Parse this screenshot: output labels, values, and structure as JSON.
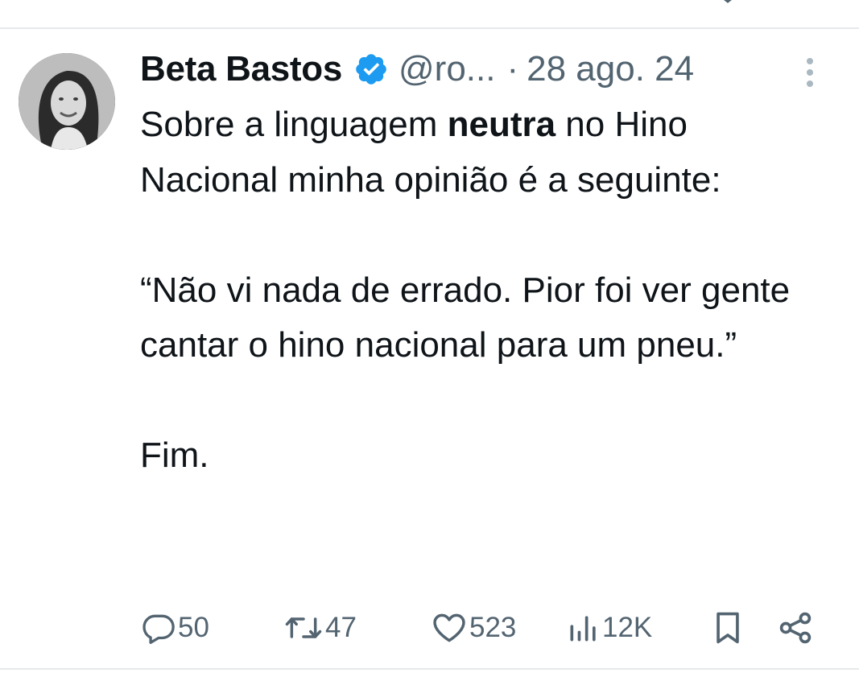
{
  "tweet": {
    "author": {
      "display_name": "Beta Bastos",
      "handle": "@ro...",
      "verified": true
    },
    "separator": "·",
    "date": "28 ago. 24",
    "text": {
      "p1_before": "Sobre a linguagem ",
      "p1_bold": "neutra",
      "p1_after": " no Hino Nacional minha opinião é a seguinte:",
      "p2": "“Não vi nada de errado. Pior foi ver gente cantar o hino nacional para um pneu.”",
      "p3": "Fim."
    },
    "stats": {
      "replies": "50",
      "reposts": "47",
      "likes": "523",
      "views": "12K"
    }
  },
  "icons": {
    "reply": "speech-bubble-icon",
    "repost": "repost-arrows-icon",
    "like": "heart-icon",
    "views": "bar-chart-icon",
    "bookmark": "bookmark-icon",
    "share": "share-nodes-icon",
    "more": "vertical-dots-icon",
    "verified": "verified-badge-icon"
  },
  "colors": {
    "text": "#0f1419",
    "secondary": "#536471",
    "verified_blue": "#1d9bf0",
    "divider": "#e6e9eb"
  }
}
